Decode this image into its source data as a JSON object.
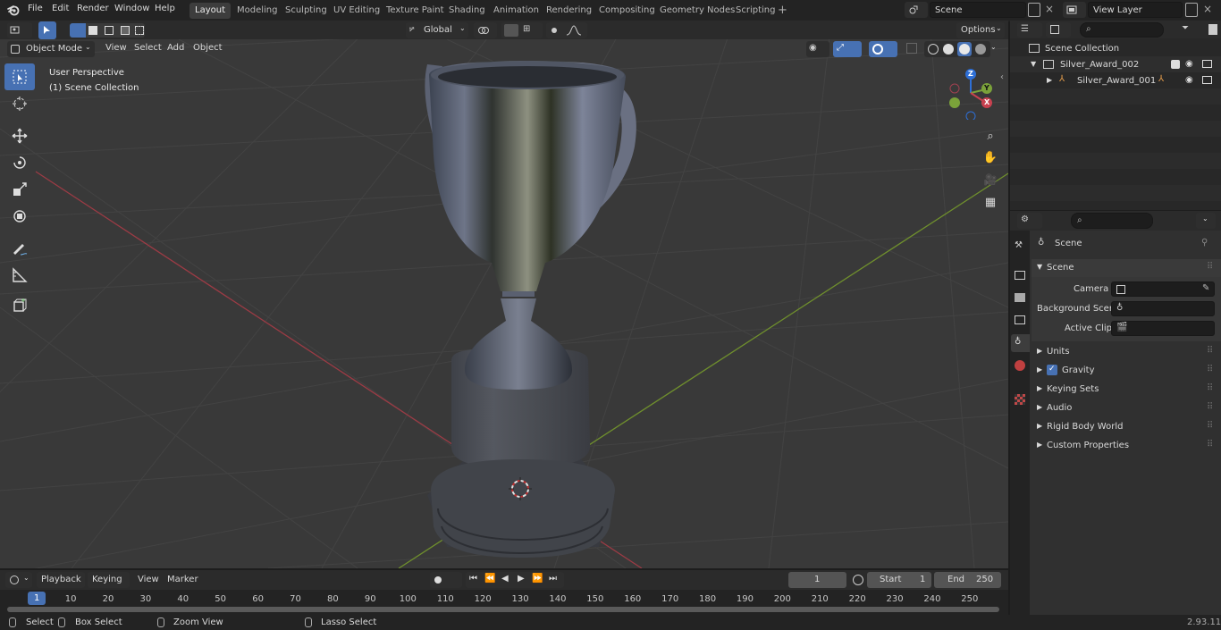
{
  "app": {
    "version": "2.93.11"
  },
  "menu": [
    "File",
    "Edit",
    "Render",
    "Window",
    "Help"
  ],
  "workspace_tabs": [
    {
      "label": "Layout",
      "active": true
    },
    {
      "label": "Modeling"
    },
    {
      "label": "Sculpting"
    },
    {
      "label": "UV Editing"
    },
    {
      "label": "Texture Paint"
    },
    {
      "label": "Shading"
    },
    {
      "label": "Animation"
    },
    {
      "label": "Rendering"
    },
    {
      "label": "Compositing"
    },
    {
      "label": "Geometry Nodes"
    },
    {
      "label": "Scripting"
    }
  ],
  "top_right": {
    "scene": "Scene",
    "view_layer": "View Layer"
  },
  "viewport_header": {
    "mode": "Object Mode",
    "menus": [
      "View",
      "Select",
      "Add",
      "Object"
    ],
    "orientation": "Global",
    "options": "Options"
  },
  "viewport": {
    "perspective": "User Perspective",
    "collection": "(1) Scene Collection",
    "gizmo_axes": {
      "z": "Z",
      "y": "Y",
      "x": "X"
    }
  },
  "outliner": {
    "root": "Scene Collection",
    "items": [
      {
        "label": "Silver_Award_002"
      },
      {
        "label": "Silver_Award_001"
      }
    ]
  },
  "properties": {
    "context": "Scene",
    "section": "Scene",
    "fields": [
      {
        "label": "Camera"
      },
      {
        "label": "Background Scene"
      },
      {
        "label": "Active Clip"
      }
    ],
    "panels": [
      {
        "label": "Units"
      },
      {
        "label": "Gravity",
        "checked": true
      },
      {
        "label": "Keying Sets"
      },
      {
        "label": "Audio"
      },
      {
        "label": "Rigid Body World"
      },
      {
        "label": "Custom Properties"
      }
    ]
  },
  "timeline": {
    "menus": [
      "Playback",
      "Keying",
      "View",
      "Marker"
    ],
    "current_frame": "1",
    "start_label": "Start",
    "start": "1",
    "end_label": "End",
    "end": "250",
    "ruler_current": "1",
    "ticks": [
      10,
      20,
      30,
      40,
      50,
      60,
      70,
      80,
      90,
      100,
      110,
      120,
      130,
      140,
      150,
      160,
      170,
      180,
      190,
      200,
      210,
      220,
      230,
      240,
      250
    ]
  },
  "statusbar": {
    "items": [
      "Select",
      "Box Select",
      "Zoom View",
      "Lasso Select"
    ]
  },
  "colors": {
    "accent": "#4771b3",
    "x_axis": "#c8414f",
    "y_axis": "#7ba23a",
    "z_axis": "#2e6fd6",
    "background": "#393939"
  }
}
